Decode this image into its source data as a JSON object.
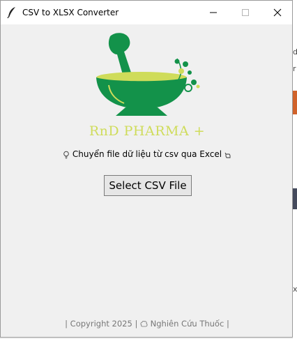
{
  "window": {
    "title": "CSV to XLSX Converter",
    "controls": {
      "minimize": "minimize",
      "maximize": "maximize",
      "close": "close"
    }
  },
  "logo": {
    "brand_text": "RnD PHARMA +",
    "colors": {
      "green": "#13924a",
      "lime": "#cfdc5a"
    }
  },
  "main": {
    "subtitle": "Chuyển file dữ liệu từ csv qua Excel",
    "leading_icon": "lightbulb-icon",
    "trailing_icon": "pointing-hand-icon",
    "select_button": "Select CSV File"
  },
  "footer": {
    "left": "| Copyright 2025 |",
    "icon": "brain-icon",
    "right": "Nghiên Cứu Thuốc |"
  }
}
